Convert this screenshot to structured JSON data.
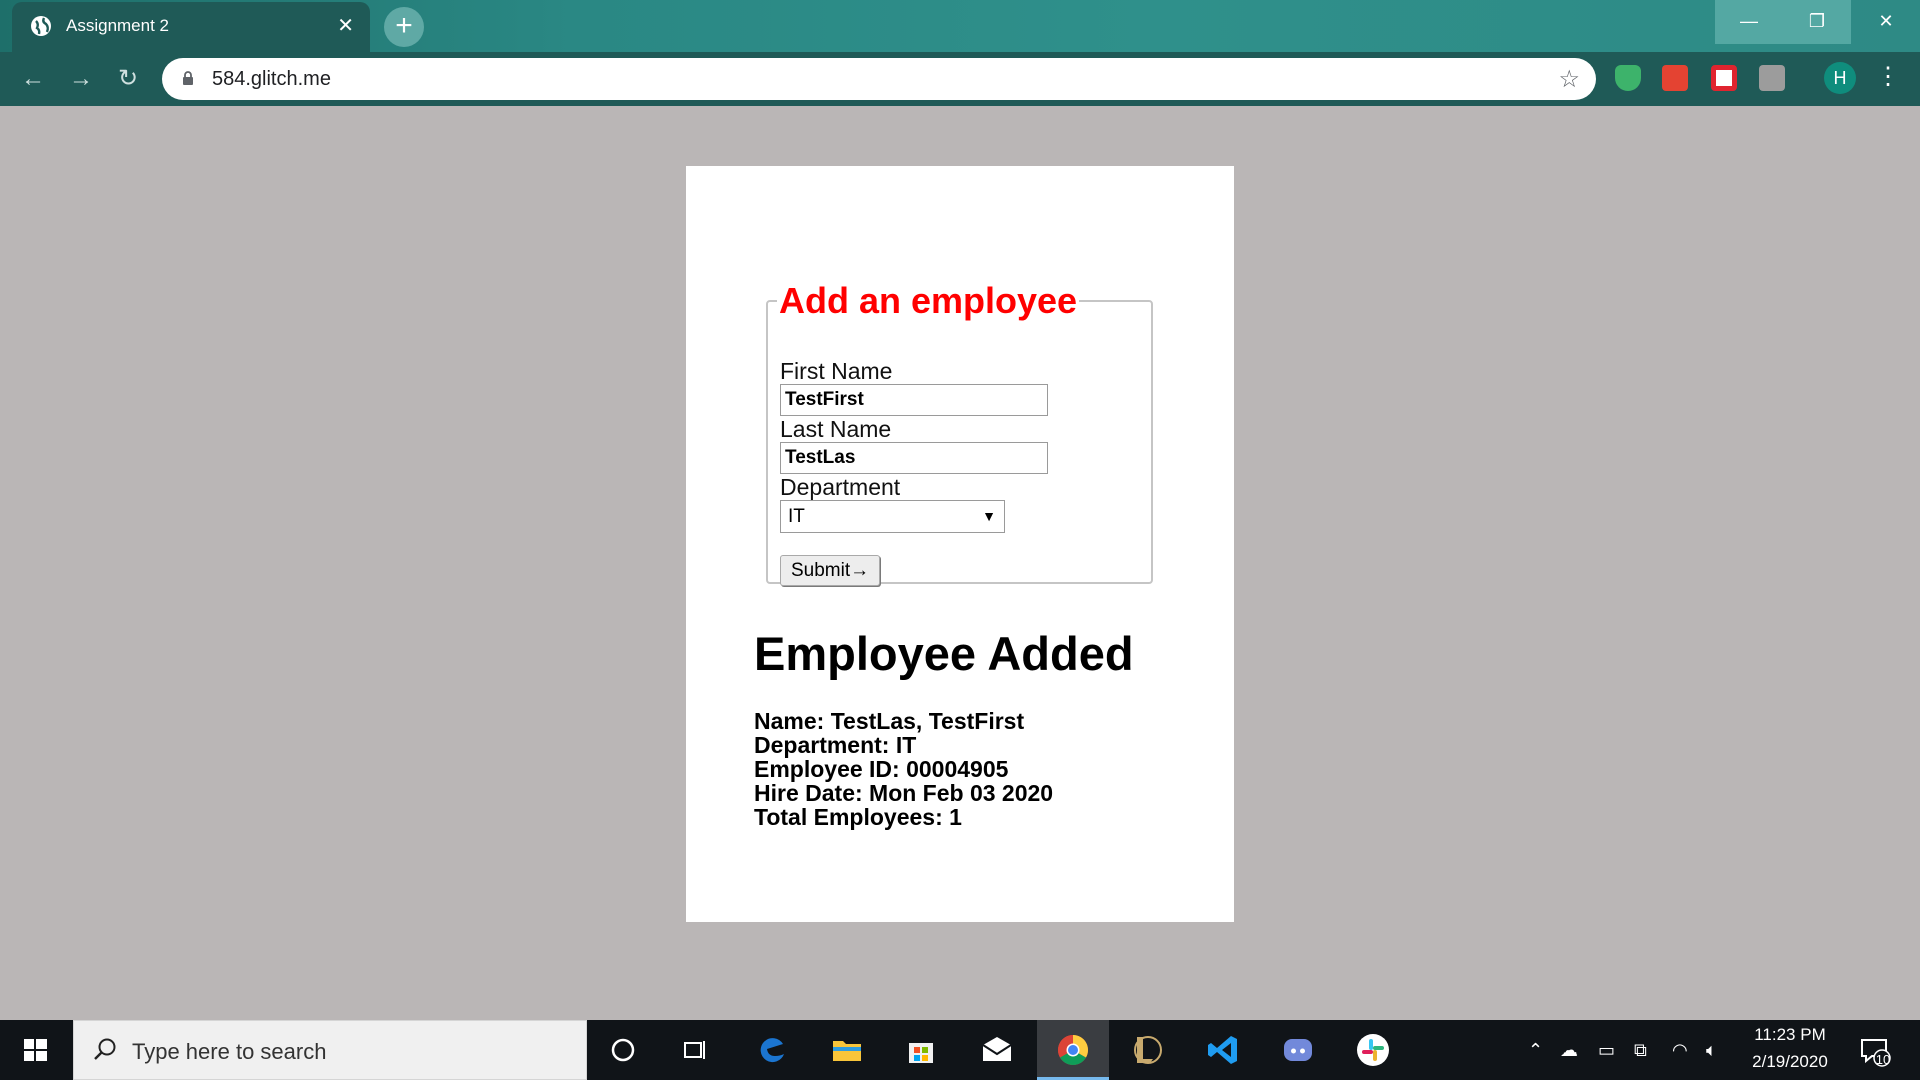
{
  "browser": {
    "tab_title": "Assignment 2",
    "tab_close": "✕",
    "new_tab": "+",
    "url": "584.glitch.me",
    "profile_initial": "H",
    "window_controls": {
      "minimize": "—",
      "restore": "❐",
      "close": "✕"
    }
  },
  "form": {
    "legend": "Add an employee",
    "first_name_label": "First Name",
    "first_name_value": "TestFirst",
    "last_name_label": "Last Name",
    "last_name_value": "TestLas",
    "department_label": "Department",
    "department_selected": "IT",
    "submit_label": "Submit→"
  },
  "result": {
    "heading": "Employee Added",
    "lines": [
      "Name: TestLas, TestFirst",
      "Department: IT",
      "Employee ID: 00004905",
      "Hire Date: Mon Feb 03 2020",
      "Total Employees: 1"
    ]
  },
  "taskbar": {
    "search_placeholder": "Type here to search",
    "time": "11:23 PM",
    "date": "2/19/2020",
    "notification_count": "10"
  },
  "colors": {
    "page_background": "#bab6b6",
    "legend_red": "#ff0000",
    "chrome_frame": "#1f5a57"
  }
}
